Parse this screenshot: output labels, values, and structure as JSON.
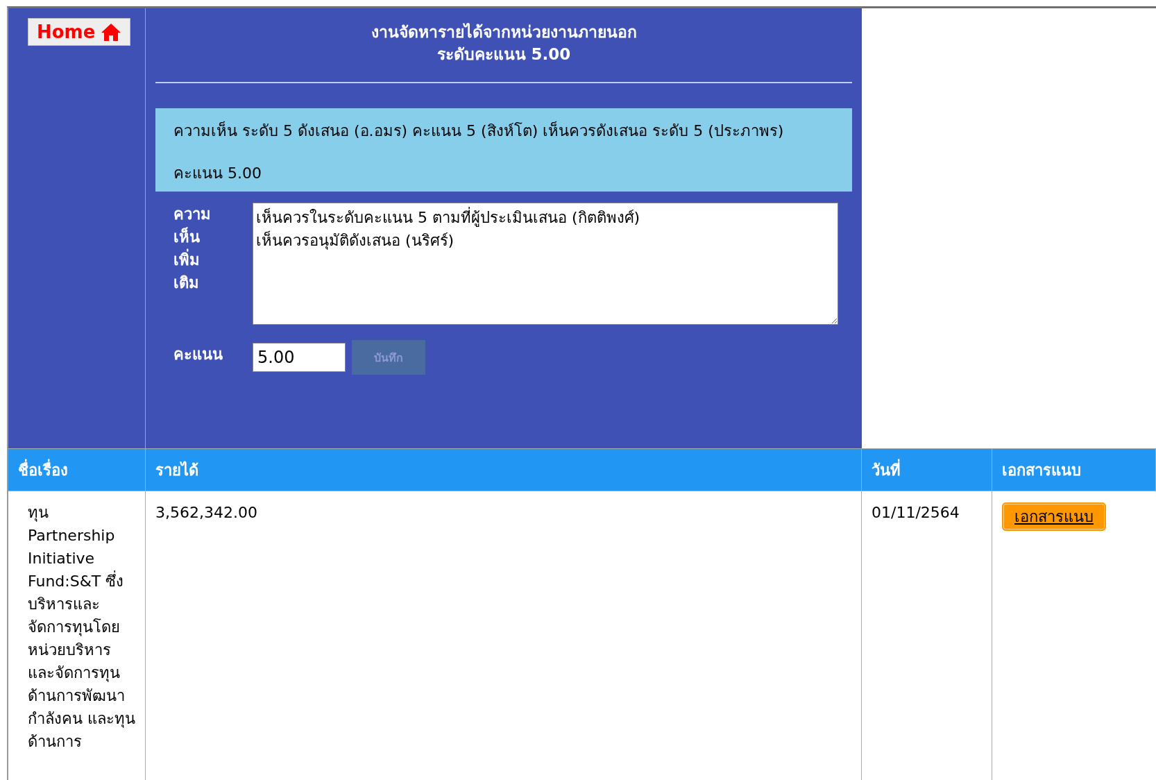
{
  "home_button": {
    "label": "Home"
  },
  "header": {
    "title": "งานจัดหารายได้จากหน่วยงานภายนอก",
    "score_level": "ระดับคะแนน 5.00"
  },
  "review_box": {
    "comment": "ความเห็น ระดับ 5 ดังเสนอ (อ.อมร) คะแนน 5 (สิงห์โต) เห็นควรดังเสนอ ระดับ 5 (ประภาพร)",
    "score": "คะแนน 5.00"
  },
  "form": {
    "comment_label": "ความเห็นเพิ่มเติม",
    "comment_value": "เห็นควรในระดับคะแนน 5 ตามที่ผู้ประเมินเสนอ (กิตติพงศ์)\nเห็นควรอนุมัติดังเสนอ (นริศร์)",
    "score_label": "คะแนน",
    "score_value": "5.00",
    "save_button": {
      "label": "บันทึก",
      "disabled": true
    }
  },
  "table": {
    "columns": [
      "ชื่อเรื่อง",
      "รายได้",
      "วันที่",
      "เอกสารแนบ"
    ],
    "rows": [
      {
        "title": "ทุน Partnership Initiative Fund:S&T ซึ่งบริหารและจัดการทุนโดยหน่วยบริหารและจัดการทุนด้านการพัฒนากำลังคน และทุนด้านการ",
        "income": "3,562,342.00",
        "date": "01/11/2564",
        "attachment": "เอกสารแนบ"
      }
    ]
  }
}
